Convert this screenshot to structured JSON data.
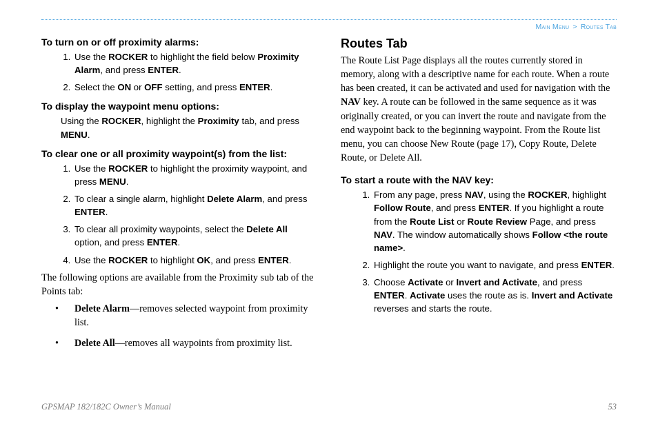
{
  "breadcrumb": {
    "left": "Main Menu",
    "sep": ">",
    "right": "Routes Tab"
  },
  "left": {
    "s1": {
      "head": "To turn on or off proximity alarms:",
      "items": [
        {
          "pre": "Use the ",
          "b1": "ROCKER",
          "mid1": " to highlight the field below ",
          "b2": "Proximity Alarm",
          "mid2": ", and press ",
          "b3": "ENTER",
          "post": "."
        },
        {
          "pre": "Select the ",
          "b1": "ON",
          "mid1": " or ",
          "b2": "OFF",
          "mid2": " setting, and press ",
          "b3": "ENTER",
          "post": "."
        }
      ]
    },
    "s2": {
      "head": "To display the waypoint menu options:",
      "line": {
        "pre": "Using the ",
        "b1": "ROCKER",
        "mid1": ", highlight the ",
        "b2": "Proximity",
        "mid2": " tab, and press ",
        "b3": "MENU",
        "post": "."
      }
    },
    "s3": {
      "head": "To clear one or all proximity waypoint(s) from the list:",
      "items": [
        {
          "pre": "Use the ",
          "b1": "ROCKER",
          "mid1": " to highlight the proximity waypoint, and press ",
          "b2": "MENU",
          "post": "."
        },
        {
          "pre": "To clear a single alarm, highlight ",
          "b1": "Delete Alarm",
          "mid1": ", and press ",
          "b2": "ENTER",
          "post": "."
        },
        {
          "pre": "To clear all proximity waypoints, select the ",
          "b1": "Delete All",
          "mid1": " option, and press ",
          "b2": "ENTER",
          "post": "."
        },
        {
          "pre": "Use the ",
          "b1": "ROCKER",
          "mid1": " to highlight ",
          "b2": "OK",
          "mid2": ", and press ",
          "b3": "ENTER",
          "post": "."
        }
      ]
    },
    "note": "The following options are available from the Proximity sub tab of the Points tab:",
    "bullets": [
      {
        "b": "Delete Alarm",
        "t": "—removes selected waypoint from proximity list."
      },
      {
        "b": "Delete All",
        "t": "—removes all waypoints from proximity list."
      }
    ]
  },
  "right": {
    "title": "Routes Tab",
    "para": {
      "pre": "The Route List Page displays all the routes currently stored in memory, along with a descriptive name for each route. When a route has been created, it can be activated and used for navigation with the ",
      "b1": "NAV",
      "mid": " key. A route can be followed in the same sequence as it was originally created, or you can invert the route and navigate from the end waypoint back to the beginning waypoint. From the Route list menu, you can choose New Route (page 17), Copy Route, Delete Route, or Delete All."
    },
    "s1": {
      "head": "To start a route with the NAV key:",
      "items": [
        {
          "pre": "From any page, press ",
          "b1": "NAV",
          "mid1": ", using the ",
          "b2": "ROCKER",
          "mid2": ", highlight ",
          "b3": "Follow Route",
          "mid3": ", and press ",
          "b4": "ENTER",
          "mid4": ". If you highlight a route from the ",
          "b5": "Route List",
          "mid5": " or ",
          "b6": "Route Review",
          "mid6": " Page, and press ",
          "b7": "NAV",
          "mid7": ". The window automatically shows ",
          "b8": "Follow <the route name>",
          "post": "."
        },
        {
          "pre": "Highlight the route you want to navigate, and press ",
          "b1": "ENTER",
          "post": "."
        },
        {
          "pre": "Choose ",
          "b1": "Activate",
          "mid1": " or ",
          "b2": "Invert and Activate",
          "mid2": ", and press ",
          "b3": "ENTER",
          "mid3": ". ",
          "b4": "Activate",
          "mid4": " uses the route as is. ",
          "b5": "Invert and Activate",
          "post": " reverses and starts the route."
        }
      ]
    }
  },
  "footer": {
    "left": "GPSMAP 182/182C Owner’s Manual",
    "right": "53"
  }
}
